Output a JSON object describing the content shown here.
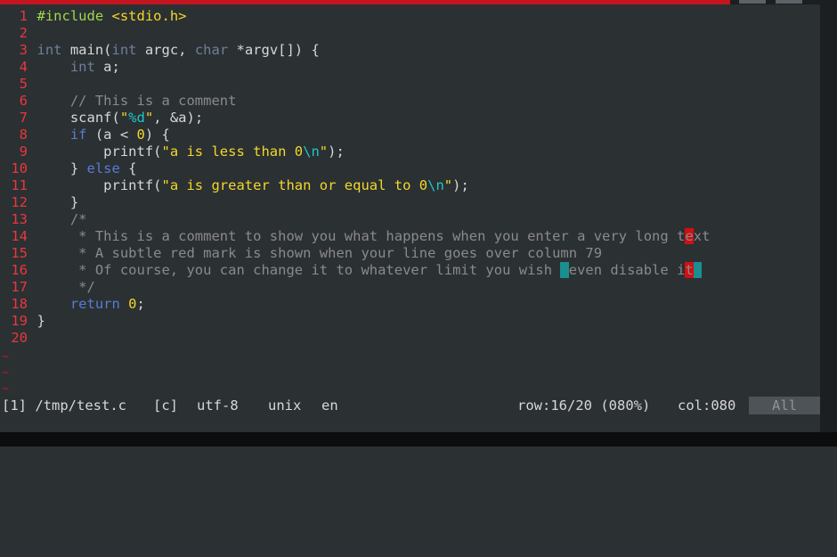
{
  "colors": {
    "background": "#2b3033",
    "line_number": "#e8383b",
    "keyword": "#5a7bd3",
    "string": "#f3d72a",
    "escape": "#1ec8c8",
    "comment": "#8a8a8a",
    "preprocessor": "#a0d74a",
    "column_marker": "#d10f12",
    "cursor": "#1b8f8f"
  },
  "editor": {
    "lines": [
      {
        "num": "1",
        "tokens": [
          {
            "t": "#include ",
            "c": "pp"
          },
          {
            "t": "<stdio.h>",
            "c": "str"
          }
        ]
      },
      {
        "num": "2",
        "tokens": []
      },
      {
        "num": "3",
        "tokens": [
          {
            "t": "int",
            "c": "ty"
          },
          {
            "t": " main("
          },
          {
            "t": "int",
            "c": "ty"
          },
          {
            "t": " argc, "
          },
          {
            "t": "char",
            "c": "ty"
          },
          {
            "t": " *argv[]) {"
          }
        ]
      },
      {
        "num": "4",
        "tokens": [
          {
            "t": "    "
          },
          {
            "t": "int",
            "c": "ty"
          },
          {
            "t": " a;"
          }
        ]
      },
      {
        "num": "5",
        "tokens": []
      },
      {
        "num": "6",
        "tokens": [
          {
            "t": "    "
          },
          {
            "t": "// This is a comment",
            "c": "cm"
          }
        ]
      },
      {
        "num": "7",
        "tokens": [
          {
            "t": "    scanf("
          },
          {
            "t": "\"",
            "c": "str"
          },
          {
            "t": "%d",
            "c": "esc"
          },
          {
            "t": "\"",
            "c": "str"
          },
          {
            "t": ", &a);"
          }
        ]
      },
      {
        "num": "8",
        "tokens": [
          {
            "t": "    "
          },
          {
            "t": "if",
            "c": "kw"
          },
          {
            "t": " (a < "
          },
          {
            "t": "0",
            "c": "num"
          },
          {
            "t": ") {"
          }
        ]
      },
      {
        "num": "9",
        "tokens": [
          {
            "t": "        printf("
          },
          {
            "t": "\"a is less than 0",
            "c": "str"
          },
          {
            "t": "\\n",
            "c": "esc"
          },
          {
            "t": "\"",
            "c": "str"
          },
          {
            "t": ");"
          }
        ]
      },
      {
        "num": "10",
        "tokens": [
          {
            "t": "    } "
          },
          {
            "t": "else",
            "c": "kw"
          },
          {
            "t": " {"
          }
        ]
      },
      {
        "num": "11",
        "tokens": [
          {
            "t": "        printf("
          },
          {
            "t": "\"a is greater than or equal to 0",
            "c": "str"
          },
          {
            "t": "\\n",
            "c": "esc"
          },
          {
            "t": "\"",
            "c": "str"
          },
          {
            "t": ");"
          }
        ]
      },
      {
        "num": "12",
        "tokens": [
          {
            "t": "    }"
          }
        ]
      },
      {
        "num": "13",
        "tokens": [
          {
            "t": "    /*",
            "c": "cm"
          }
        ]
      },
      {
        "num": "14",
        "tokens": [
          {
            "t": "     * This is a comment to show you what happens when you enter a very long t",
            "c": "cm"
          },
          {
            "t": "e",
            "c": "red-hl"
          },
          {
            "t": "xt",
            "c": "cm"
          }
        ]
      },
      {
        "num": "15",
        "tokens": [
          {
            "t": "     * A subtle red mark is shown when your line goes over column 79",
            "c": "cm"
          }
        ]
      },
      {
        "num": "16",
        "tokens": [
          {
            "t": "     * Of course, you can change it to whatever limit you wish ",
            "c": "cm"
          },
          {
            "t": "(",
            "c": "teal-hl"
          },
          {
            "t": "even disable i",
            "c": "cm"
          },
          {
            "t": "t",
            "c": "red-hl"
          },
          {
            "t": ")",
            "c": "teal-hl"
          }
        ]
      },
      {
        "num": "17",
        "tokens": [
          {
            "t": "     */",
            "c": "cm"
          }
        ]
      },
      {
        "num": "18",
        "tokens": [
          {
            "t": "    "
          },
          {
            "t": "return",
            "c": "kw"
          },
          {
            "t": " "
          },
          {
            "t": "0",
            "c": "num"
          },
          {
            "t": ";"
          }
        ]
      },
      {
        "num": "19",
        "tokens": [
          {
            "t": "}"
          }
        ]
      },
      {
        "num": "20",
        "tokens": []
      }
    ],
    "tildes": [
      "~",
      "~",
      "~"
    ]
  },
  "status": {
    "buffer": "[1] /tmp/test.c",
    "filetype": "[c]",
    "encoding": "utf-8",
    "format": "unix",
    "lang": "en",
    "row": "row:16/20 (080%)",
    "col": "col:080",
    "position": "All"
  }
}
